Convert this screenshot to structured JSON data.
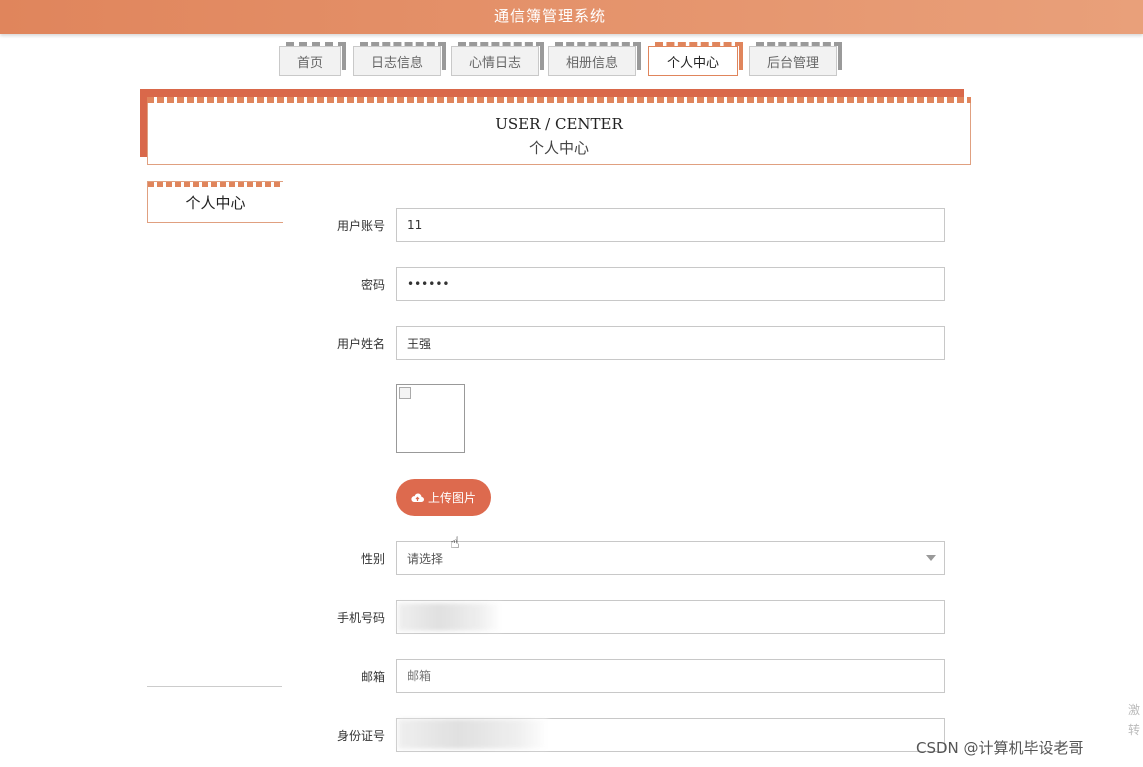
{
  "app": {
    "title": "通信簿管理系统"
  },
  "nav": {
    "items": [
      {
        "label": "首页"
      },
      {
        "label": "日志信息"
      },
      {
        "label": "心情日志"
      },
      {
        "label": "相册信息"
      },
      {
        "label": "个人中心"
      },
      {
        "label": "后台管理"
      }
    ],
    "active": "个人中心"
  },
  "header": {
    "title_en": "USER / CENTER",
    "title_cn": "个人中心"
  },
  "sidebar": {
    "items": [
      {
        "label": "个人中心"
      }
    ]
  },
  "form": {
    "account": {
      "label": "用户账号",
      "value": "11"
    },
    "password": {
      "label": "密码",
      "value": "••••••"
    },
    "name": {
      "label": "用户姓名",
      "value": "王强"
    },
    "upload": {
      "label": "上传图片"
    },
    "gender": {
      "label": "性别",
      "value": "请选择"
    },
    "phone": {
      "label": "手机号码",
      "value": ""
    },
    "email": {
      "label": "邮箱",
      "placeholder": "邮箱"
    },
    "idcard": {
      "label": "身份证号",
      "value": ""
    }
  },
  "colors": {
    "accent": "#e0855c",
    "button": "#dd6a4e"
  },
  "watermark": "CSDN @计算机毕设老哥",
  "side_hint": [
    "激",
    "转"
  ]
}
